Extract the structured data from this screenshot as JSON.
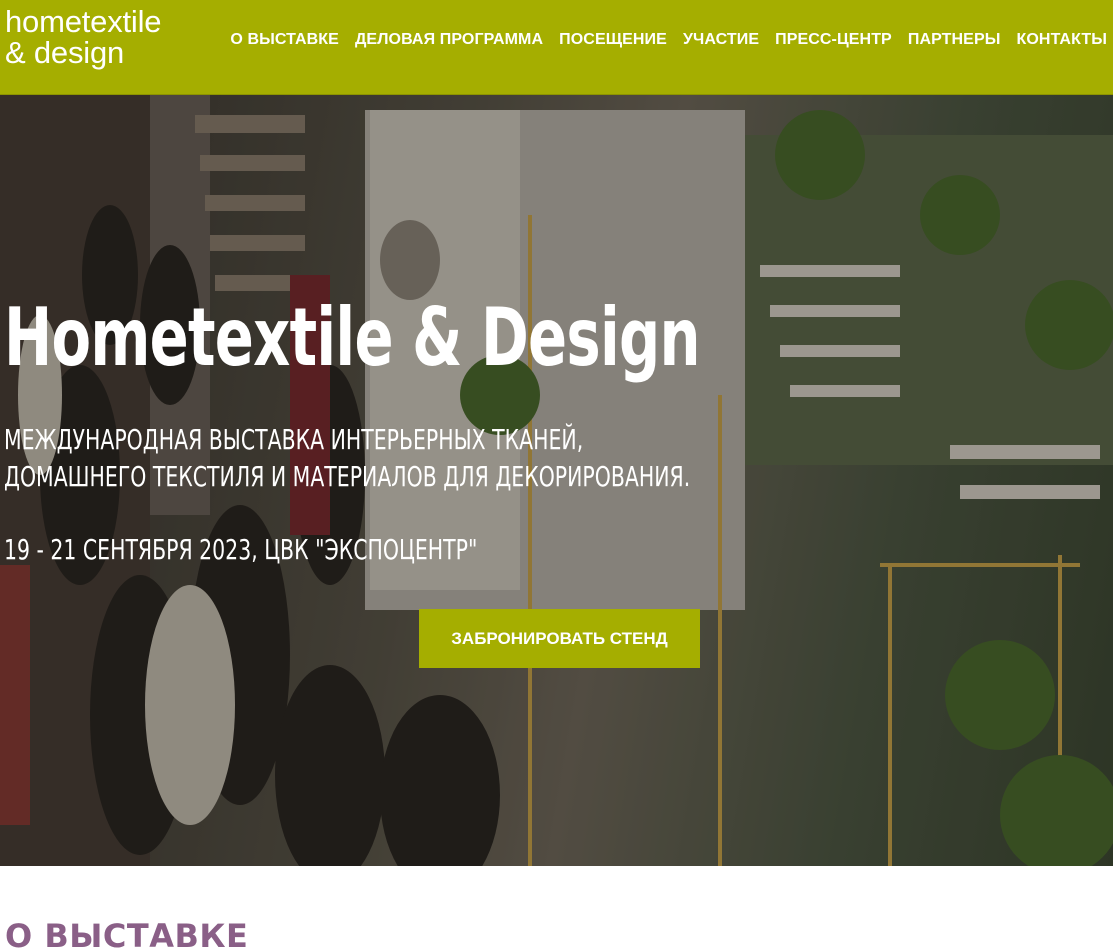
{
  "header": {
    "logo_line1": "hometextile",
    "logo_line2": "& design",
    "nav": [
      {
        "label": "О ВЫСТАВКЕ"
      },
      {
        "label": "ДЕЛОВАЯ ПРОГРАММА"
      },
      {
        "label": "ПОСЕЩЕНИЕ"
      },
      {
        "label": "УЧАСТИЕ"
      },
      {
        "label": "ПРЕСС-ЦЕНТР"
      },
      {
        "label": "ПАРТНЕРЫ"
      },
      {
        "label": "КОНТАКТЫ"
      }
    ]
  },
  "hero": {
    "title": "Hometextile & Design",
    "subtitle_line1": "МЕЖДУНАРОДНАЯ ВЫСТАВКА ИНТЕРЬЕРНЫХ ТКАНЕЙ,",
    "subtitle_line2": "ДОМАШНЕГО ТЕКСТИЛЯ И МАТЕРИАЛОВ ДЛЯ ДЕКОРИРОВАНИЯ.",
    "date": "19 - 21 СЕНТЯБРЯ 2023, ЦВК \"ЭКСПОЦЕНТР\"",
    "cta_label": "ЗАБРОНИРОВАТЬ СТЕНД"
  },
  "about": {
    "title": "О ВЫСТАВКЕ"
  },
  "colors": {
    "brand": "#a5ae00",
    "section_title": "#8a5f87"
  }
}
